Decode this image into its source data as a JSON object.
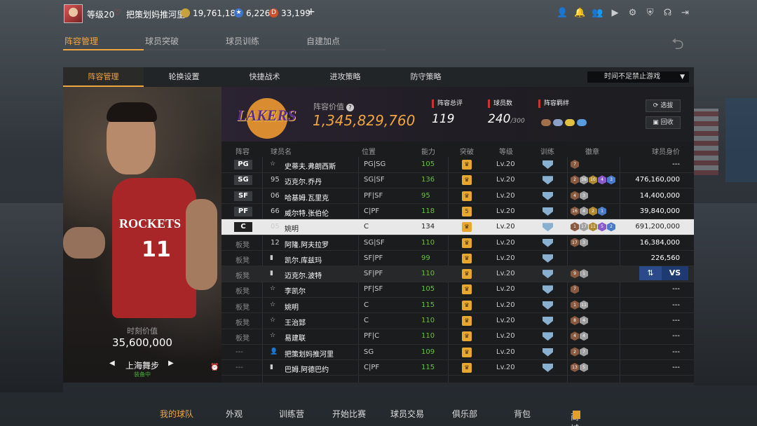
{
  "user": {
    "level": "等级20",
    "nickname": "把策划妈推河里",
    "coins": "19,761,183",
    "stars": "6,226",
    "tokens": "33,199",
    "plus": "+"
  },
  "main_tabs": [
    {
      "label": "阵容管理",
      "active": true
    },
    {
      "label": "球员突破"
    },
    {
      "label": "球员训练"
    },
    {
      "label": "自建加点"
    }
  ],
  "sub_tabs": [
    {
      "label": "阵容管理",
      "active": true
    },
    {
      "label": "轮换设置"
    },
    {
      "label": "快捷战术"
    },
    {
      "label": "进攻策略"
    },
    {
      "label": "防守策略"
    }
  ],
  "dropdown": {
    "value": "时间不足禁止游戏"
  },
  "player_card": {
    "market_value_label": "时刻价值",
    "market_value": "35,600,000",
    "team": "上海舞步",
    "status": "装备中"
  },
  "team": {
    "logo_text": "LAKERS",
    "value_label": "阵容价值",
    "value": "1,345,829,760",
    "total_rating_label": "阵容总评",
    "total_rating": "119",
    "player_count_label": "球员数",
    "player_count": "240",
    "player_count_max": "/300",
    "bond_label": "阵容羁绊",
    "select_btn": "选拔",
    "recycle_btn": "回收"
  },
  "table": {
    "headers": [
      "阵容",
      "球员名",
      "位置",
      "能力",
      "突破",
      "等级",
      "训练",
      "徽章",
      "球员身价"
    ],
    "rows": [
      {
        "role": "PG",
        "ovr": "☆",
        "name": "史蒂夫.弗朗西斯",
        "pos": "PG|SG",
        "ability": "105",
        "break": "♛",
        "level": "Lv.20",
        "badges": [
          [
            "7",
            "br"
          ]
        ],
        "value": "---"
      },
      {
        "role": "SG",
        "ovr": "95",
        "name": "迈克尔.乔丹",
        "pos": "SG|SF",
        "ability": "136",
        "break": "♛",
        "level": "Lv.20",
        "badges": [
          [
            "2",
            "br"
          ],
          [
            "36",
            "gy"
          ],
          [
            "10",
            "gd"
          ],
          [
            "4",
            "pu"
          ],
          [
            "3",
            "bl"
          ]
        ],
        "value": "476,160,000"
      },
      {
        "role": "SF",
        "ovr": "06",
        "name": "哈基姆.瓦里克",
        "pos": "PF|SF",
        "ability": "95",
        "break": "♛",
        "level": "Lv.20",
        "badges": [
          [
            "4",
            "br"
          ],
          [
            "3",
            "gy"
          ]
        ],
        "value": "14,400,000"
      },
      {
        "role": "PF",
        "ovr": "66",
        "name": "威尔特.张伯伦",
        "pos": "C|PF",
        "ability": "118",
        "break": "5",
        "level": "Lv.20",
        "badges": [
          [
            "16",
            "br"
          ],
          [
            "4",
            "gy"
          ],
          [
            "2",
            "gd"
          ],
          [
            "1",
            "bl"
          ]
        ],
        "value": "39,840,000"
      },
      {
        "role": "C",
        "ovr": "05",
        "name": "姚明",
        "pos": "C",
        "ability": "134",
        "break": "♛",
        "level": "Lv.20",
        "badges": [
          [
            "1",
            "br"
          ],
          [
            "17",
            "gy"
          ],
          [
            "11",
            "gd"
          ],
          [
            "5",
            "pu"
          ],
          [
            "2",
            "bl"
          ]
        ],
        "value": "691,200,000",
        "highlight": true
      },
      {
        "role": "板凳",
        "ovr": "12",
        "name": "阿隆.阿夫拉罗",
        "pos": "SG|SF",
        "ability": "110",
        "break": "♛",
        "level": "Lv.20",
        "badges": [
          [
            "17",
            "br"
          ],
          [
            "3",
            "gy"
          ]
        ],
        "value": "16,384,000"
      },
      {
        "role": "板凳",
        "ovr": "▮",
        "name": "凯尔.库兹玛",
        "pos": "SF|PF",
        "ability": "99",
        "break": "♛",
        "level": "Lv.20",
        "badges": [],
        "value": "226,560"
      },
      {
        "role": "板凳",
        "ovr": "▮",
        "name": "迈克尔.波特",
        "pos": "SF|PF",
        "ability": "110",
        "break": "♛",
        "level": "Lv.20",
        "badges": [
          [
            "9",
            "br"
          ],
          [
            "1",
            "gy"
          ]
        ],
        "value": "",
        "vs": true
      },
      {
        "role": "板凳",
        "ovr": "☆",
        "name": "李凯尔",
        "pos": "PF|SF",
        "ability": "105",
        "break": "♛",
        "level": "Lv.20",
        "badges": [
          [
            "7",
            "br"
          ]
        ],
        "value": "---"
      },
      {
        "role": "板凳",
        "ovr": "☆",
        "name": "姚明",
        "pos": "C",
        "ability": "115",
        "break": "♛",
        "level": "Lv.20",
        "badges": [
          [
            "1",
            "br"
          ],
          [
            "11",
            "gy"
          ]
        ],
        "value": "---"
      },
      {
        "role": "板凳",
        "ovr": "☆",
        "name": "王治郅",
        "pos": "C",
        "ability": "110",
        "break": "♛",
        "level": "Lv.20",
        "badges": [
          [
            "8",
            "br"
          ],
          [
            "4",
            "gy"
          ]
        ],
        "value": "---"
      },
      {
        "role": "板凳",
        "ovr": "☆",
        "name": "易建联",
        "pos": "PF|C",
        "ability": "110",
        "break": "♛",
        "level": "Lv.20",
        "badges": [
          [
            "4",
            "br"
          ],
          [
            "4",
            "gy"
          ]
        ],
        "value": "---"
      },
      {
        "role": "---",
        "ovr": "👤",
        "name": "把策划妈推河里",
        "pos": "SG",
        "ability": "109",
        "break": "♛",
        "level": "Lv.20",
        "badges": [
          [
            "2",
            "br"
          ],
          [
            "7",
            "gy"
          ]
        ],
        "value": "---"
      },
      {
        "role": "---",
        "ovr": "▮",
        "name": "巴姆.阿德巴约",
        "pos": "C|PF",
        "ability": "115",
        "break": "♛",
        "level": "Lv.20",
        "badges": [
          [
            "13",
            "br"
          ],
          [
            "5",
            "gy"
          ]
        ],
        "value": "---",
        "clock": true
      }
    ]
  },
  "vs": {
    "swap": "⇅",
    "label": "VS"
  },
  "bottom_nav": [
    {
      "label": "我的球队",
      "active": true
    },
    {
      "label": "外观"
    },
    {
      "label": "训练营"
    },
    {
      "label": "开始比赛"
    },
    {
      "label": "球员交易"
    },
    {
      "label": "俱乐部"
    },
    {
      "label": "背包"
    },
    {
      "label": "商城"
    }
  ],
  "colors": {
    "accent": "#f0a640",
    "ability_green": "#6bc040",
    "stat_red": "#cc3333"
  }
}
